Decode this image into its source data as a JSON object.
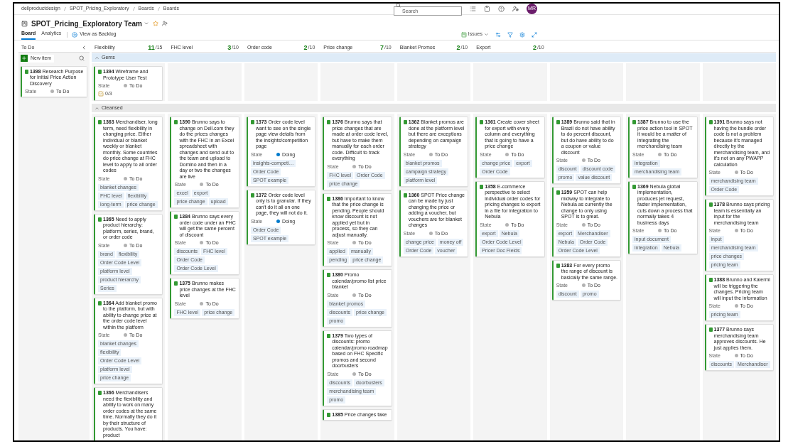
{
  "breadcrumbs": [
    "dellproductdesign",
    "SPOT_Pricing_Exploratory",
    "Boards",
    "Boards"
  ],
  "search": {
    "placeholder": "Search"
  },
  "avatar": "MR",
  "team": "SPOT_Pricing_Exploratory Team",
  "tabs": [
    {
      "label": "Board",
      "selected": true
    },
    {
      "label": "Analytics",
      "selected": false
    }
  ],
  "view_backlog": "View as Backlog",
  "work_item_type": "Issues",
  "incoming": {
    "title": "To Do",
    "new_item": "New item",
    "cards": [
      {
        "id": "1398",
        "title": "Research Purpose for Initial Price Action Discovery",
        "state_label": "State",
        "state": "To Do",
        "color": "#b2b2b2"
      }
    ]
  },
  "columns": [
    {
      "title": "Flexibility",
      "count": "11",
      "limit": "/15"
    },
    {
      "title": "FHC level",
      "count": "3",
      "limit": "/10"
    },
    {
      "title": "Order code",
      "count": "2",
      "limit": "/10"
    },
    {
      "title": "Price change",
      "count": "7",
      "limit": "/10"
    },
    {
      "title": "Blanket Promos",
      "count": "2",
      "limit": "/10"
    },
    {
      "title": "Export",
      "count": "2",
      "limit": "/10"
    }
  ],
  "lanes": [
    {
      "title": "Gems",
      "selected": true,
      "expanded": true,
      "cells": [
        {
          "cards": [
            {
              "id": "1394",
              "title": "Wireframe and Prototype User Test",
              "state_label": "State",
              "state": "To Do",
              "color": "#b2b2b2",
              "checklist": "0/3"
            }
          ]
        },
        {},
        {},
        {},
        {},
        {},
        {},
        {},
        {}
      ]
    },
    {
      "title": "Cleansed",
      "selected": false,
      "expanded": true,
      "cells": [
        {
          "cards": [
            {
              "id": "1363",
              "title": "Merchandiser, long term, need flexibility in changing price. Either individual or blanket weekly or blanket monthly. Some countries do price change at FHC level to apply to all order codes",
              "state_label": "State",
              "state": "To Do",
              "color": "#b2b2b2",
              "tags": [
                "blanket changes",
                "FHC level",
                "flexibility",
                "long-term",
                "price change"
              ]
            },
            {
              "id": "1365",
              "title": "Need to apply product hierarchy: platform, series, brand, or order code",
              "state_label": "State",
              "state": "To Do",
              "color": "#b2b2b2",
              "tags": [
                "brand",
                "flexibility",
                "Order Code Level",
                "platform level",
                "product hierarchy",
                "Series"
              ]
            },
            {
              "id": "1364",
              "title": "Add blanket promo to the platform, but with ability to change price at the order code level within the platform",
              "state_label": "State",
              "state": "To Do",
              "color": "#b2b2b2",
              "tags": [
                "blanket changes",
                "flexibility",
                "Order Code Level",
                "platform level",
                "price change"
              ]
            },
            {
              "id": "1366",
              "title": "Merchandisers need the flexibility and ability to work on many order codes at the same time. Normally they do it by their structure of products. You have: product"
            }
          ]
        },
        {
          "cards": [
            {
              "id": "1390",
              "title": "Brunno says to change on Dell.com they do the prices changes with the FHC in an Excel spreadsheet with changes and send out to the team and upload to Domino and then in a day or two the changes are live",
              "state_label": "State",
              "state": "To Do",
              "color": "#b2b2b2",
              "tags": [
                "excel",
                "export",
                "price change",
                "upload"
              ]
            },
            {
              "id": "1384",
              "title": "Brunno says every order code under an FHC will get the same percent of discount",
              "state_label": "State",
              "state": "To Do",
              "color": "#b2b2b2",
              "tags": [
                "discounts",
                "FHC level",
                "Order Code",
                "Order Code Level"
              ]
            },
            {
              "id": "1375",
              "title": "Brunno makes price changes at the FHC level",
              "state_label": "State",
              "state": "To Do",
              "color": "#b2b2b2",
              "tags": [
                "FHC level",
                "price change"
              ]
            }
          ]
        },
        {
          "cards": [
            {
              "id": "1373",
              "title": "Order code level want to see on the single page view details from the insights/competition page",
              "state_label": "State",
              "state": "Doing",
              "color": "#007acc",
              "tags": [
                "insights-competi…",
                "Order Code",
                "SPOT example"
              ]
            },
            {
              "id": "1372",
              "title": "Order code level only is to granular. If they can't do it all on one page, they will not do it.",
              "state_label": "State",
              "state": "Doing",
              "color": "#007acc",
              "tags": [
                "Order Code",
                "SPOT example"
              ]
            }
          ]
        },
        {
          "cards": [
            {
              "id": "1376",
              "title": "Brunno says that price changes that are made at order code level, but have to make them manually for each order code. Difficult to track everything",
              "state_label": "State",
              "state": "To Do",
              "color": "#b2b2b2",
              "tags": [
                "FHC level",
                "Order Code",
                "price change"
              ]
            },
            {
              "id": "1386",
              "title": "Important to know that the price change is pending. People should know discount is not applied yet but in process, so they can adjust manually.",
              "state_label": "State",
              "state": "To Do",
              "color": "#b2b2b2",
              "tags": [
                "applied",
                "manually",
                "pending",
                "price change"
              ]
            },
            {
              "id": "1380",
              "title": "Promo calendar/promo list price blanket",
              "state_label": "State",
              "state": "To Do",
              "color": "#b2b2b2",
              "tags": [
                "blanket promos",
                "discounts",
                "price change",
                "promo"
              ]
            },
            {
              "id": "1379",
              "title": "Two types of discounts: promo calendar/promo roadmap based on FHC Specific promos and second doorbusters",
              "state_label": "State",
              "state": "To Do",
              "color": "#b2b2b2",
              "tags": [
                "discounts",
                "doorbusters",
                "merchandising team",
                "promo"
              ]
            },
            {
              "id": "1385",
              "title": "Price changes take"
            }
          ]
        },
        {
          "cards": [
            {
              "id": "1362",
              "title": "Blanket promos are done at the platform level but there are exceptions depending on campaign strategy",
              "state_label": "State",
              "state": "To Do",
              "color": "#b2b2b2",
              "tags": [
                "blanket promos",
                "campaign strategy",
                "platform level"
              ]
            },
            {
              "id": "1360",
              "title": "SPOT Price change can be made by just changing the price or adding a voucher, but vouchers are for blanket changes",
              "state_label": "State",
              "state": "To Do",
              "color": "#b2b2b2",
              "tags": [
                "change price",
                "money off",
                "Order Code",
                "voucher"
              ]
            }
          ]
        },
        {
          "cards": [
            {
              "id": "1361",
              "title": "Create cover sheet for export with every column and everything that is going to have a price change",
              "state_label": "State",
              "state": "To Do",
              "color": "#b2b2b2",
              "tags": [
                "change price",
                "export",
                "Order Code"
              ]
            },
            {
              "id": "1358",
              "title": "E-commerce perspective to select individual order codes for pricing changes to export in a file for integration to Nebula",
              "state_label": "State",
              "state": "To Do",
              "color": "#b2b2b2",
              "tags": [
                "export",
                "Nebula",
                "Order Code Level",
                "Pricer Doc Fields"
              ]
            }
          ]
        },
        {
          "cards": [
            {
              "id": "1389",
              "title": "Brunno said that in Brazil do not have ability to do percent discount, but do have ability to do a coupon or value discount",
              "state_label": "State",
              "state": "To Do",
              "color": "#b2b2b2",
              "tags": [
                "discount",
                "discount code",
                "promo",
                "value discount"
              ]
            },
            {
              "id": "1359",
              "title": "SPOT can help midway to integrate to Nebula as currently the change to only using SPOT is to great.",
              "state_label": "State",
              "state": "To Do",
              "color": "#b2b2b2",
              "tags": [
                "export",
                "Merchandiser",
                "Nebula",
                "Order Code",
                "Order Code Level"
              ]
            },
            {
              "id": "1383",
              "title": "For every promo the range of discount is basically the same range.",
              "state_label": "State",
              "state": "To Do",
              "color": "#b2b2b2",
              "tags": [
                "discount",
                "promo"
              ]
            }
          ]
        },
        {
          "cards": [
            {
              "id": "1387",
              "title": "Brunno to use the price action tool in SPOT it would be a matter of integrating the merchandising team",
              "state_label": "State",
              "state": "To Do",
              "color": "#b2b2b2",
              "tags": [
                "integration",
                "merchandising team"
              ]
            },
            {
              "id": "1369",
              "title": "Nebula global implementation, produces jet request, faster implementation, cuts down a process that normally takes 4 business days",
              "state_label": "State",
              "state": "To Do",
              "color": "#b2b2b2",
              "tags": [
                "input document",
                "integration",
                "Nebula"
              ]
            }
          ]
        },
        {
          "cards": [
            {
              "id": "1391",
              "title": "Brunno says not having the bundle order code is not a problem because it's managed directly by the merchandising team, and it's not on any PWAPP calculation",
              "state_label": "State",
              "state": "To Do",
              "color": "#b2b2b2",
              "tags": [
                "merchandising team",
                "Order Code"
              ]
            },
            {
              "id": "1378",
              "title": "Brunno says pricing team is essentially an input for the merchandising team",
              "state_label": "State",
              "state": "To Do",
              "color": "#b2b2b2",
              "tags": [
                "input",
                "merchandising team",
                "price changes",
                "pricing team"
              ]
            },
            {
              "id": "1388",
              "title": "Brunno and Kalermi will be triggering the changes. Pricing team will input the information",
              "state_label": "State",
              "state": "To Do",
              "color": "#b2b2b2",
              "tags": [
                "pricing team"
              ]
            },
            {
              "id": "1377",
              "title": "Brunno says merchandising team approves discounts. He just applies them.",
              "state_label": "State",
              "state": "To Do",
              "color": "#b2b2b2",
              "tags": [
                "discounts",
                "Merchandiser"
              ]
            }
          ]
        }
      ]
    }
  ]
}
